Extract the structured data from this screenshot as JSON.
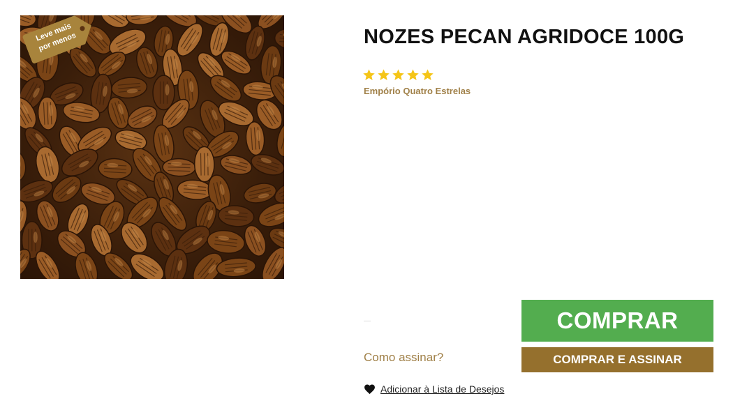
{
  "product": {
    "title": "NOZES PECAN AGRIDOCE 100G",
    "rating_stars": 5,
    "rating_max": 5,
    "brand": "Empório Quatro Estrelas",
    "promo_tag_line1": "Leve mais",
    "promo_tag_line2": "por menos",
    "price_placeholder": "—"
  },
  "actions": {
    "buy_label": "COMPRAR",
    "buy_subscribe_label": "COMPRAR E ASSINAR",
    "how_subscribe_label": "Como assinar?",
    "wishlist_label": "Adicionar à Lista de Desejos"
  },
  "icons": {
    "star": "star-icon",
    "heart": "heart-icon"
  },
  "colors": {
    "title": "#111111",
    "star": "#f5c518",
    "brand": "#a08048",
    "buy_button": "#53ad4f",
    "buy_subscribe_button": "#95702d",
    "promo_tag": "#a8843c"
  }
}
